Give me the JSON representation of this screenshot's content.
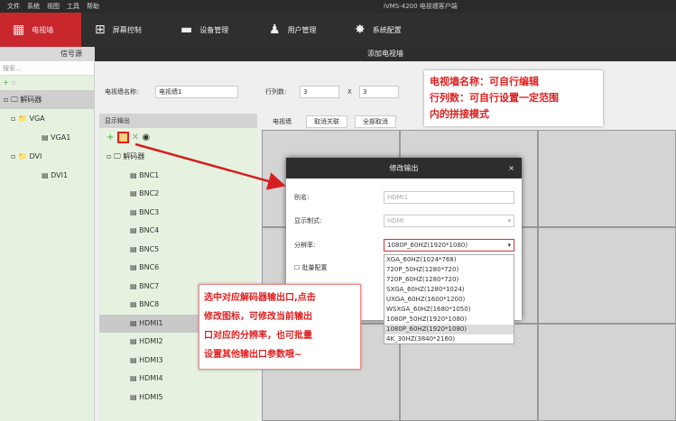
{
  "menu": [
    "文件",
    "系统",
    "视图",
    "工具",
    "帮助"
  ],
  "app_title": "iVMS-4200 电视墙客户端",
  "nav": [
    {
      "label": "电视墙",
      "icon": "tv-wall-icon"
    },
    {
      "label": "屏幕控制",
      "icon": "grid-icon"
    },
    {
      "label": "设备管理",
      "icon": "device-icon"
    },
    {
      "label": "用户管理",
      "icon": "user-icon"
    },
    {
      "label": "系统配置",
      "icon": "gear-icon"
    }
  ],
  "sidebar": {
    "title": "信号源",
    "search_placeholder": "搜索...",
    "tree": [
      "解码器",
      "VGA",
      "VGA1",
      "DVI",
      "DVI1"
    ]
  },
  "main": {
    "title": "添加电视墙",
    "name_label": "电视墙名称:",
    "name_value": "电视墙1",
    "rc_label": "行列数:",
    "rows": "3",
    "x": "X",
    "cols": "3"
  },
  "note1": [
    "电视墙名称：可自行编辑",
    "行列数：可自行设置一定范围",
    "内的拼接模式"
  ],
  "output": {
    "title": "显示输出",
    "root": "解码器",
    "items": [
      "BNC1",
      "BNC2",
      "BNC3",
      "BNC4",
      "BNC5",
      "BNC6",
      "BNC7",
      "BNC8",
      "HDMI1",
      "HDMI2",
      "HDMI3",
      "HDMI4",
      "HDMI5"
    ],
    "selected": "HDMI1"
  },
  "wall": {
    "buttons": [
      "电视墙",
      "取消关联",
      "全部取消"
    ]
  },
  "modal": {
    "title": "修改输出",
    "close": "×",
    "alias_label": "别名:",
    "alias_value": "HDMI1",
    "mode_label": "显示制式:",
    "mode_value": "HDMI",
    "res_label": "分辨率:",
    "res_value": "1080P_60HZ(1920*1080)",
    "batch_label": "批量配置"
  },
  "res_options": [
    "XGA_60HZ(1024*768)",
    "720P_50HZ(1280*720)",
    "720P_60HZ(1280*720)",
    "SXGA_60HZ(1280*1024)",
    "UXGA_60HZ(1600*1200)",
    "WSXGA_60HZ(1680*1050)",
    "1080P_50HZ(1920*1080)",
    "1080P_60HZ(1920*1080)",
    "4K_30HZ(3840*2160)"
  ],
  "note2": [
    "选中对应解码器输出口,点击",
    "修改图标，可修改当前输出",
    "口对应的分辨率，也可批量",
    "设置其他输出口参数哦~"
  ]
}
